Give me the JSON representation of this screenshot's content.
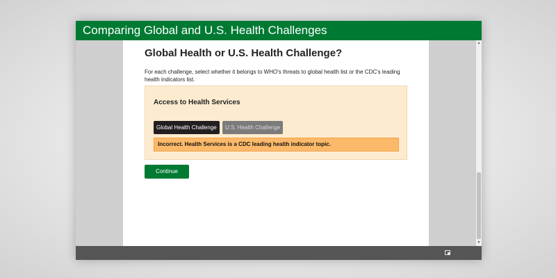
{
  "window": {
    "title": "Comparing Global and U.S. Health Challenges"
  },
  "page": {
    "heading": "Global Health or U.S. Health Challenge?",
    "instructions": "For each challenge, select whether it belongs to WHO's threats to global health list or the CDC's leading health indicators list."
  },
  "question": {
    "challenge": "Access to Health Services",
    "options": [
      {
        "label": "Global Health Challenge",
        "state": "selected"
      },
      {
        "label": "U.S. Health Challenge",
        "state": "unselected"
      }
    ],
    "feedback": "Incorrect. Health Services is a CDC leading health indicator topic."
  },
  "actions": {
    "continue_label": "Continue"
  },
  "footer": {
    "icons": [
      "expand-icon"
    ]
  },
  "colors": {
    "brand_green": "#007a33",
    "panel_bg": "#fdebd0",
    "feedback_bg": "#fdb96a",
    "selected_option_bg": "#231f20",
    "unselected_option_bg": "#7b7b7b"
  }
}
